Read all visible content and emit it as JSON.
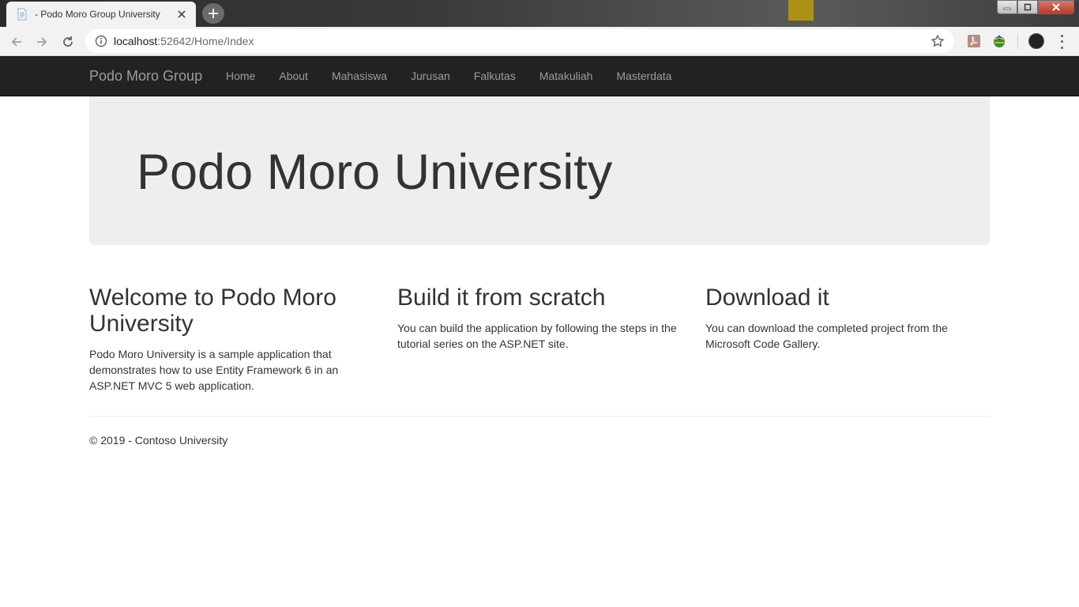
{
  "browser": {
    "tab_title": "- Podo Moro Group University",
    "url_host": "localhost",
    "url_path": ":52642/Home/Index"
  },
  "navbar": {
    "brand": "Podo Moro Group",
    "links": [
      "Home",
      "About",
      "Mahasiswa",
      "Jurusan",
      "Falkutas",
      "Matakuliah",
      "Masterdata"
    ],
    "background": "#222222",
    "link_color": "#9d9d9d"
  },
  "jumbotron": {
    "title": "Podo Moro University",
    "background": "#eeeeee"
  },
  "columns": [
    {
      "heading": "Welcome to Podo Moro University",
      "body": "Podo Moro University is a sample application that demonstrates how to use Entity Framework 6 in an ASP.NET MVC 5 web application."
    },
    {
      "heading": "Build it from scratch",
      "body": "You can build the application by following the steps in the tutorial series on the ASP.NET site."
    },
    {
      "heading": "Download it",
      "body": "You can download the completed project from the Microsoft Code Gallery."
    }
  ],
  "footer": {
    "text": "© 2019 - Contoso University"
  },
  "icons": [
    "page-icon",
    "close-icon",
    "plus-icon",
    "back-arrow-icon",
    "forward-arrow-icon",
    "reload-icon",
    "info-icon",
    "star-icon",
    "pdf-extension-icon",
    "globe-extension-icon",
    "profile-avatar",
    "menu-kebab-icon"
  ]
}
